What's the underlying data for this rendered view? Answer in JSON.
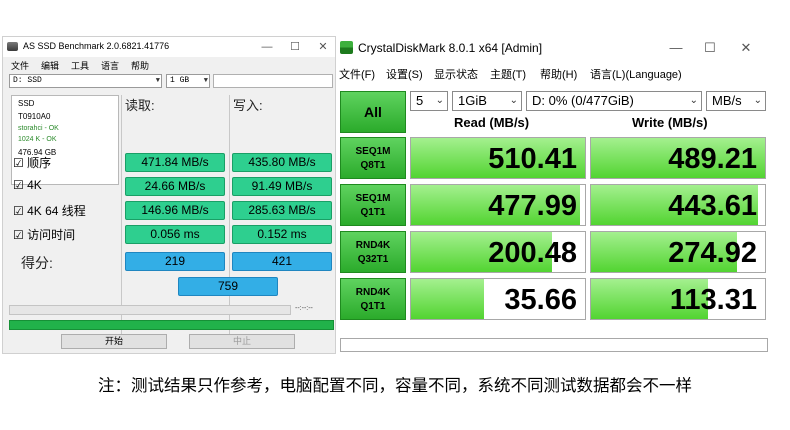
{
  "as_ssd": {
    "title": "AS SSD Benchmark 2.0.6821.41776",
    "menu": [
      "文件",
      "编辑",
      "工具",
      "语言",
      "帮助"
    ],
    "drive_select": "D: SSD",
    "size_select": "1 GB",
    "drive_info": [
      "SSD",
      "T0910A0",
      "storahci - OK",
      "1024 K - OK",
      "476.94 GB"
    ],
    "read_header": "读取:",
    "write_header": "写入:",
    "rows": [
      {
        "label": "☑ 顺序",
        "read": "471.84 MB/s",
        "write": "435.80 MB/s"
      },
      {
        "label": "☑ 4K",
        "read": "24.66 MB/s",
        "write": "91.49 MB/s"
      },
      {
        "label": "☑ 4K 64 线程",
        "read": "146.96 MB/s",
        "write": "285.63 MB/s"
      },
      {
        "label": "☑ 访问时间",
        "read": "0.056 ms",
        "write": "0.152 ms"
      }
    ],
    "score_label": "得分:",
    "score_read": "219",
    "score_write": "421",
    "score_total": "759",
    "time_label": "--:--:--",
    "start_button": "开始",
    "stop_button": "中止"
  },
  "cdm": {
    "title": "CrystalDiskMark 8.0.1 x64 [Admin]",
    "menu": [
      "文件(F)",
      "设置(S)",
      "显示状态",
      "主题(T)",
      "帮助(H)",
      "语言(L)(Language)"
    ],
    "all_button": "All",
    "count_select": "5",
    "size_select": "1GiB",
    "drive_select": "D: 0% (0/477GiB)",
    "unit_select": "MB/s",
    "read_header": "Read (MB/s)",
    "write_header": "Write (MB/s)",
    "tests": [
      {
        "line1": "SEQ1M",
        "line2": "Q8T1",
        "read": "510.41",
        "write": "489.21",
        "read_fill": 1.0,
        "write_fill": 1.0
      },
      {
        "line1": "SEQ1M",
        "line2": "Q1T1",
        "read": "477.99",
        "write": "443.61",
        "read_fill": 0.97,
        "write_fill": 0.96
      },
      {
        "line1": "RND4K",
        "line2": "Q32T1",
        "read": "200.48",
        "write": "274.92",
        "read_fill": 0.81,
        "write_fill": 0.84
      },
      {
        "line1": "RND4K",
        "line2": "Q1T1",
        "read": "35.66",
        "write": "113.31",
        "read_fill": 0.42,
        "write_fill": 0.67
      }
    ]
  },
  "note": "注：测试结果只作参考，电脑配置不同，容量不同，系统不同测试数据都会不一样"
}
